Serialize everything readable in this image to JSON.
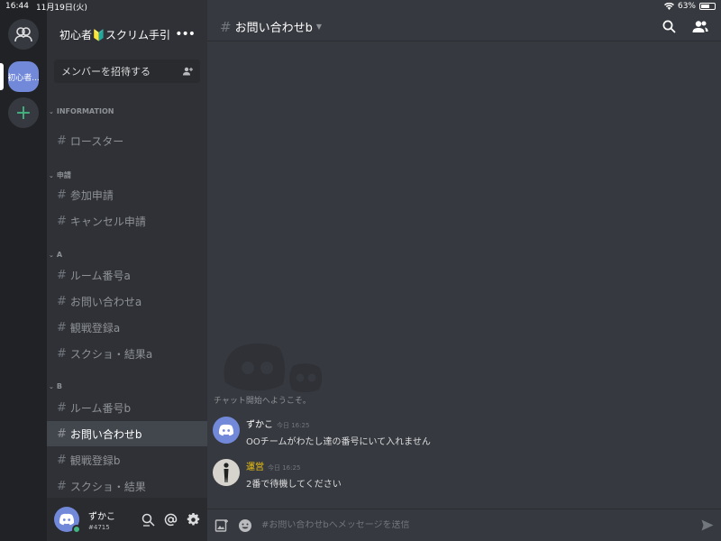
{
  "status_bar": {
    "time": "16:44",
    "date": "11月19日(火)",
    "battery": "63%",
    "battery_level": 0.63
  },
  "rail": {
    "server_label": "初心者...",
    "add_symbol": "+"
  },
  "server": {
    "name": "初心者🔰スクリム手引",
    "more": "•••",
    "invite_label": "メンバーを招待する"
  },
  "categories": [
    {
      "name": "INFORMATION",
      "channels": [
        "ロースター"
      ]
    },
    {
      "name": "申請",
      "channels": [
        "参加申請",
        "キャンセル申請"
      ]
    },
    {
      "name": "A",
      "channels": [
        "ルーム番号a",
        "お問い合わせa",
        "観戦登録a",
        "スクショ・結果a"
      ]
    },
    {
      "name": "B",
      "channels": [
        "ルーム番号b",
        "お問い合わせb",
        "観戦登録b",
        "スクショ・結果"
      ]
    }
  ],
  "active_channel": "お問い合わせb",
  "user": {
    "name": "ずかこ",
    "tag": "#4715"
  },
  "main": {
    "channel_title": "お問い合わせb",
    "welcome": "チャット開始へようこそ。",
    "messages": [
      {
        "author": "ずかこ",
        "time": "今日 16:25",
        "text": "OOチームがわたし達の番号にいて入れません"
      },
      {
        "author": "運営",
        "time": "今日 16:25",
        "text": "2番で待機してください"
      }
    ],
    "composer_placeholder": "#お問い合わせbへメッセージを送信"
  },
  "colors": {
    "accent": "#7289da",
    "online": "#43b581",
    "admin_name": "#f1c40f"
  }
}
